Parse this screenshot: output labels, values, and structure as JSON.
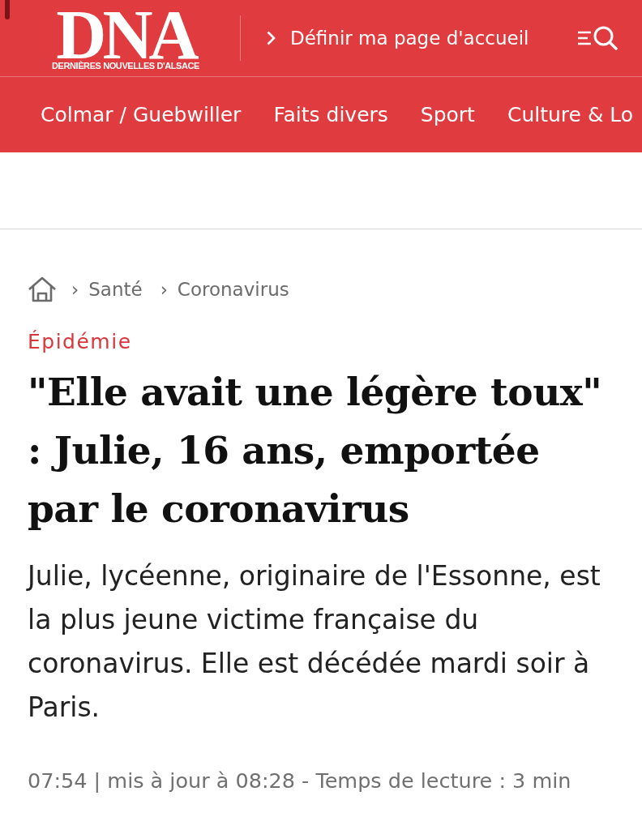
{
  "header": {
    "logo": {
      "title": "DNA",
      "subtitle": "DERNIÈRES NOUVELLES D'ALSACE"
    },
    "homepage_link": "Définir ma page d'accueil"
  },
  "nav": {
    "items": [
      "Colmar / Guebwiller",
      "Faits divers",
      "Sport",
      "Culture & Lo"
    ]
  },
  "breadcrumb": [
    {
      "separator": "›",
      "label": "Santé"
    },
    {
      "separator": "›",
      "label": "Coronavirus"
    }
  ],
  "article": {
    "category": "Épidémie",
    "headline": "\"Elle avait une légère toux\" : Julie, 16 ans, emportée par le coronavirus",
    "summary": "Julie, lycéenne, originaire de l'Essonne, est la plus jeune victime française du coronavirus. Elle est décédée mardi soir à Paris.",
    "meta": "07:54 | mis à jour à 08:28 - Temps de lecture : 3 min"
  }
}
